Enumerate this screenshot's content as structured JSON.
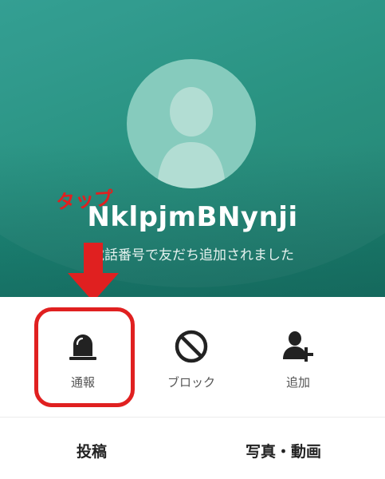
{
  "profile": {
    "name": "NklpjmBNynji",
    "subtitle": "電話番号で友だち追加されました",
    "avatar_icon": "default-person-avatar-icon"
  },
  "annotation": {
    "tap_label": "タップ",
    "arrow_icon": "down-arrow-icon",
    "color": "#e02020"
  },
  "actions": [
    {
      "label": "通報",
      "icon": "siren-icon"
    },
    {
      "label": "ブロック",
      "icon": "block-icon"
    },
    {
      "label": "追加",
      "icon": "add-friend-icon"
    }
  ],
  "tabs": [
    {
      "label": "投稿"
    },
    {
      "label": "写真・動画"
    }
  ],
  "colors": {
    "header": "#1f8e7c",
    "avatar_bg": "#86cbbd",
    "icon": "#222222"
  }
}
